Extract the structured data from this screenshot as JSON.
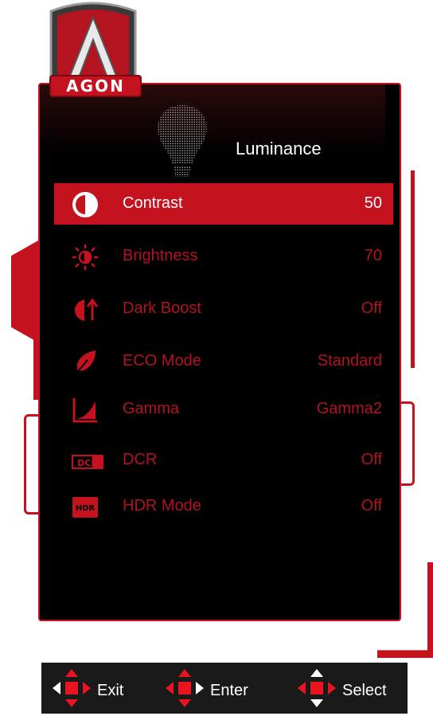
{
  "logo": {
    "text": "AGON"
  },
  "menu": {
    "title": "Luminance",
    "items": [
      {
        "label": "Contrast",
        "value": "50",
        "icon": "contrast-icon",
        "selected": true
      },
      {
        "label": "Brightness",
        "value": "70",
        "icon": "brightness-icon",
        "selected": false
      },
      {
        "label": "Dark Boost",
        "value": "Off",
        "icon": "dark-boost-icon",
        "selected": false
      },
      {
        "label": "ECO Mode",
        "value": "Standard",
        "icon": "eco-mode-icon",
        "selected": false
      },
      {
        "label": "Gamma",
        "value": "Gamma2",
        "icon": "gamma-icon",
        "selected": false
      },
      {
        "label": "DCR",
        "value": "Off",
        "icon": "dcr-icon",
        "selected": false
      },
      {
        "label": "HDR Mode",
        "value": "Off",
        "icon": "hdr-icon",
        "selected": false
      }
    ]
  },
  "footer": {
    "exit_label": "Exit",
    "enter_label": "Enter",
    "select_label": "Select"
  },
  "colors": {
    "accent": "#c4121f",
    "text_dim": "#b3121f",
    "text_bright": "#ffffff"
  },
  "icons": {
    "dcr_text": "DCR",
    "hdr_text": "HDR"
  }
}
